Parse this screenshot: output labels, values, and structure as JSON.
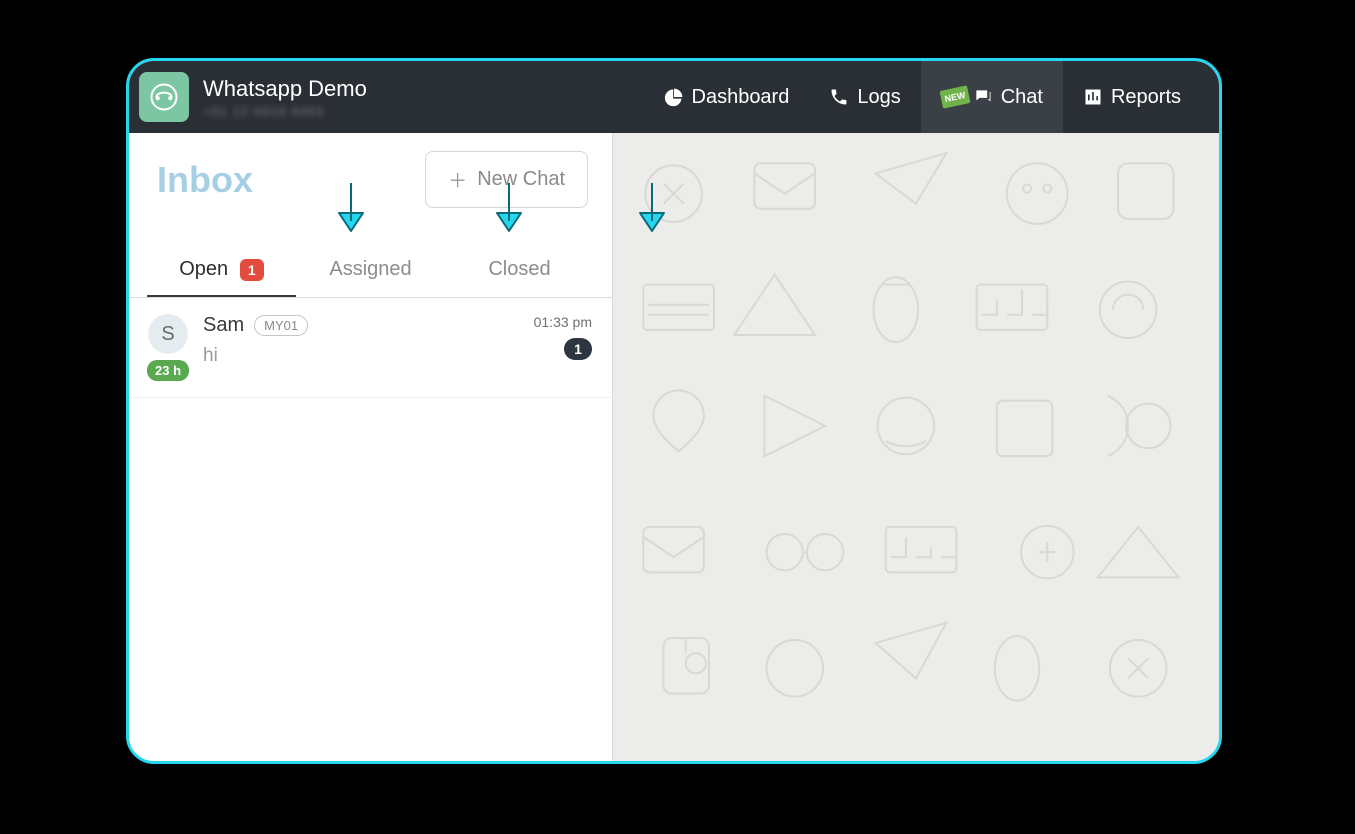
{
  "header": {
    "title": "Whatsapp Demo",
    "subtitle": "+91 22 6919 9483"
  },
  "nav": {
    "dashboard": "Dashboard",
    "logs": "Logs",
    "chat": "Chat",
    "reports": "Reports",
    "new_badge": "NEW"
  },
  "inbox": {
    "title": "Inbox",
    "new_chat_label": "New Chat",
    "tabs": {
      "open": {
        "label": "Open",
        "count": "1"
      },
      "assigned": {
        "label": "Assigned"
      },
      "closed": {
        "label": "Closed"
      }
    }
  },
  "conversations": [
    {
      "initial": "S",
      "age": "23 h",
      "name": "Sam",
      "tag": "MY01",
      "preview": "hi",
      "time": "01:33 pm",
      "unread": "1"
    }
  ]
}
